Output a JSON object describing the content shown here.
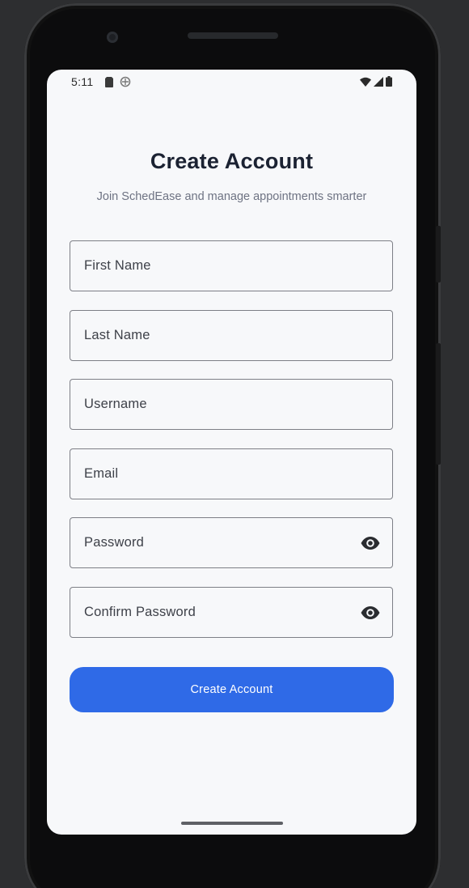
{
  "status_bar": {
    "time": "5:11",
    "left_icons": [
      "sim-card-icon",
      "data-saver-icon"
    ],
    "right_icons": [
      "wifi-icon",
      "cellular-signal-icon",
      "battery-icon"
    ]
  },
  "header": {
    "title": "Create Account",
    "subtitle": "Join SchedEase and manage appointments smarter"
  },
  "form": {
    "fields": [
      {
        "label": "First Name",
        "value": "",
        "type": "text"
      },
      {
        "label": "Last Name",
        "value": "",
        "type": "text"
      },
      {
        "label": "Username",
        "value": "",
        "type": "text"
      },
      {
        "label": "Email",
        "value": "",
        "type": "email"
      },
      {
        "label": "Password",
        "value": "",
        "type": "password",
        "toggle_icon": "visibility-eye-icon"
      },
      {
        "label": "Confirm Password",
        "value": "",
        "type": "password",
        "toggle_icon": "visibility-eye-icon"
      }
    ],
    "submit_label": "Create Account"
  },
  "colors": {
    "primary": "#2f6ae7",
    "background": "#f7f8fa",
    "title": "#1b2232",
    "subtitle": "#6e7383",
    "field_border": "#7d7f86"
  }
}
